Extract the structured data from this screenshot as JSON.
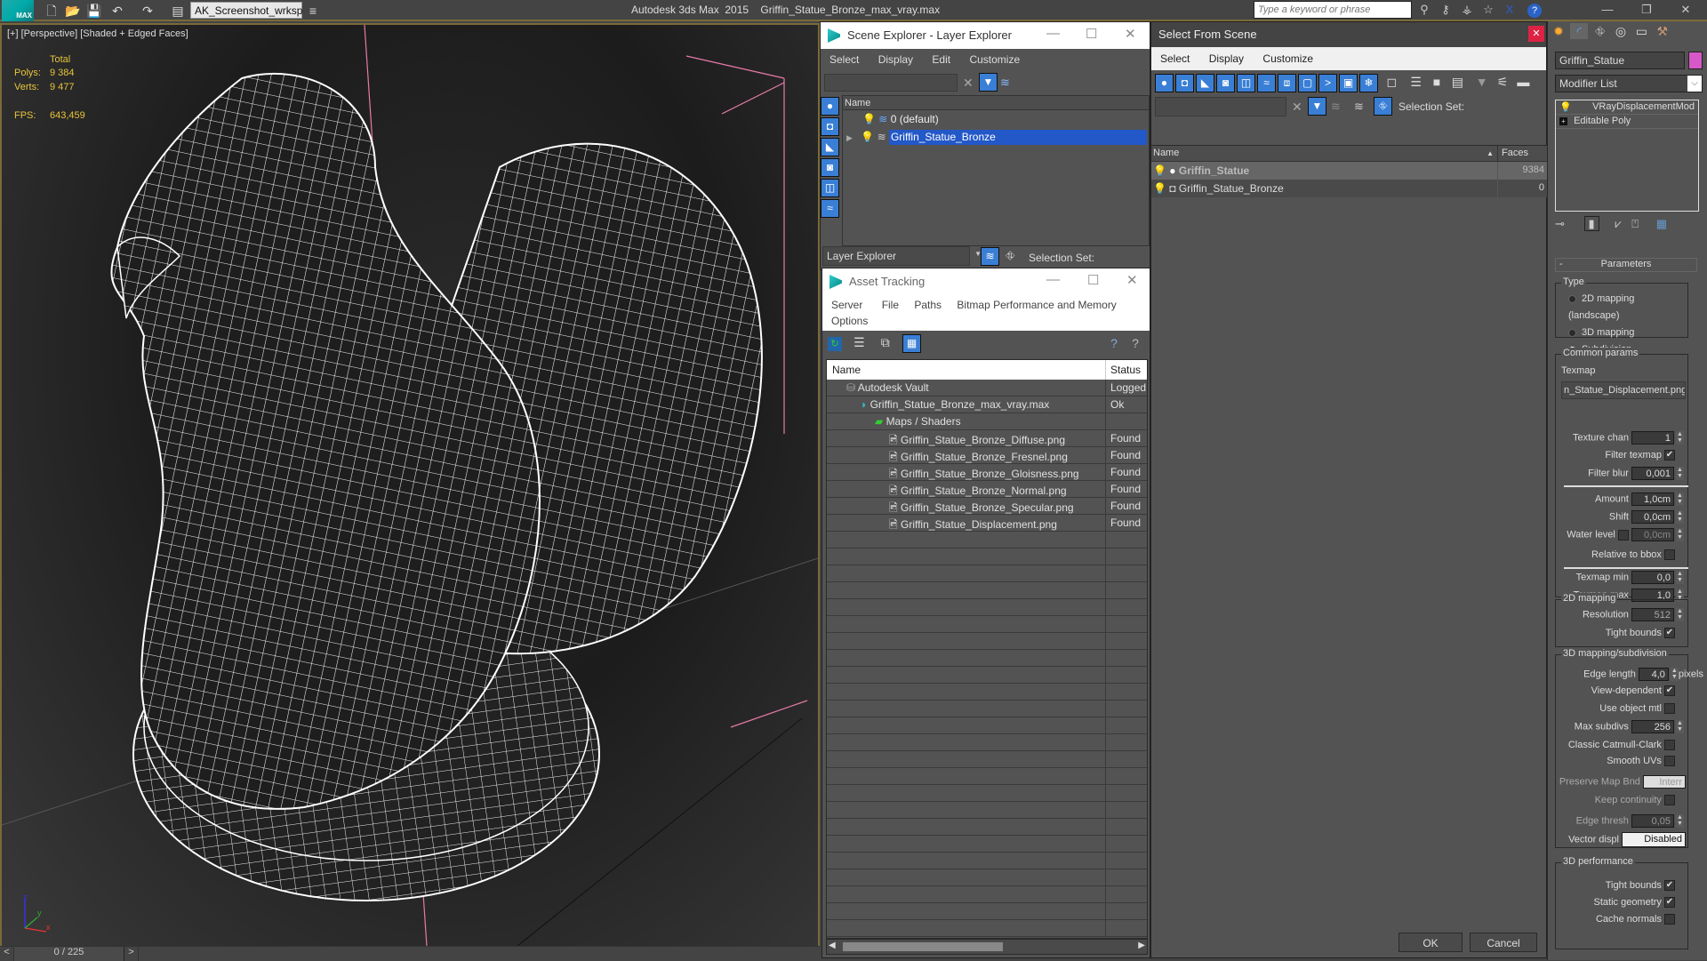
{
  "titlebar": {
    "workspace": "AK_Screenshot_wrksp",
    "app_title": "Autodesk 3ds Max  2015    Griffin_Statue_Bronze_max_vray.max",
    "search_placeholder": "Type a keyword or phrase"
  },
  "viewport": {
    "label": "[+] [Perspective] [Shaded + Edged Faces]",
    "stats_header": "Total",
    "polys_label": "Polys:",
    "polys_value": "9 384",
    "verts_label": "Verts:",
    "verts_value": "9 477",
    "fps_label": "FPS:",
    "fps_value": "643,459",
    "axis_x": "x",
    "axis_y": "y",
    "axis_z": "z"
  },
  "timeline": {
    "prev": "<",
    "frame": "0 / 225",
    "next": ">"
  },
  "scene_explorer": {
    "title": "Scene Explorer - Layer Explorer",
    "menu": [
      "Select",
      "Display",
      "Edit",
      "Customize"
    ],
    "column_name": "Name",
    "layers": [
      {
        "name": "0 (default)",
        "selected": false
      },
      {
        "name": "Griffin_Statue_Bronze",
        "selected": true
      }
    ],
    "footer_dropdown": "Layer Explorer",
    "selection_set_label": "Selection Set:"
  },
  "asset_tracking": {
    "title": "Asset Tracking",
    "menu": [
      "Server",
      "File",
      "Paths",
      "Bitmap Performance and Memory",
      "Options"
    ],
    "columns": [
      "Name",
      "Status"
    ],
    "rows": [
      {
        "name": "Autodesk Vault",
        "status": "Logged",
        "indent": 0,
        "icon": "vault-icon"
      },
      {
        "name": "Griffin_Statue_Bronze_max_vray.max",
        "status": "Ok",
        "indent": 1,
        "icon": "max-file-icon"
      },
      {
        "name": "Maps / Shaders",
        "status": "",
        "indent": 2,
        "icon": "maps-icon"
      },
      {
        "name": "Griffin_Statue_Bronze_Diffuse.png",
        "status": "Found",
        "indent": 3,
        "icon": "image-file-icon"
      },
      {
        "name": "Griffin_Statue_Bronze_Fresnel.png",
        "status": "Found",
        "indent": 3,
        "icon": "image-file-icon"
      },
      {
        "name": "Griffin_Statue_Bronze_Gloisness.png",
        "status": "Found",
        "indent": 3,
        "icon": "image-file-icon"
      },
      {
        "name": "Griffin_Statue_Bronze_Normal.png",
        "status": "Found",
        "indent": 3,
        "icon": "image-file-icon"
      },
      {
        "name": "Griffin_Statue_Bronze_Specular.png",
        "status": "Found",
        "indent": 3,
        "icon": "image-file-icon"
      },
      {
        "name": "Griffin_Statue_Displacement.png",
        "status": "Found",
        "indent": 3,
        "icon": "image-file-icon"
      }
    ]
  },
  "select_from_scene": {
    "title": "Select From Scene",
    "menu": [
      "Select",
      "Display",
      "Customize"
    ],
    "selection_set_label": "Selection Set:",
    "columns": [
      "Name",
      "Faces"
    ],
    "rows": [
      {
        "name": "Griffin_Statue",
        "faces": "9384",
        "selected": true
      },
      {
        "name": "Griffin_Statue_Bronze",
        "faces": "0",
        "selected": false
      }
    ],
    "ok": "OK",
    "cancel": "Cancel"
  },
  "command_panel": {
    "object_name": "Griffin_Statue",
    "object_color": "#d858c8",
    "modifier_list": "Modifier List",
    "stack": [
      "VRayDisplacementMod",
      "Editable Poly"
    ],
    "rollout_title": "Parameters",
    "type_group": "Type",
    "type_options": [
      {
        "label": "2D mapping (landscape)",
        "selected": false
      },
      {
        "label": "3D mapping",
        "selected": false
      },
      {
        "label": "Subdivision",
        "selected": true
      }
    ],
    "common_group": "Common params",
    "texmap_label": "Texmap",
    "texmap_value": "n_Statue_Displacement.png)",
    "texture_chan_label": "Texture chan",
    "texture_chan": "1",
    "filter_texmap_label": "Filter texmap",
    "filter_texmap": true,
    "filter_blur_label": "Filter blur",
    "filter_blur": "0,001",
    "amount_label": "Amount",
    "amount": "1,0cm",
    "shift_label": "Shift",
    "shift": "0,0cm",
    "water_level_label": "Water level",
    "water_level": "0,0cm",
    "relative_bbox_label": "Relative to bbox",
    "texmap_min_label": "Texmap min",
    "texmap_min": "0,0",
    "texmap_max_label": "Texmap max",
    "texmap_max": "1,0",
    "group_2d": "2D mapping",
    "resolution_label": "Resolution",
    "resolution": "512",
    "tight_bounds_label": "Tight bounds",
    "group_3d": "3D mapping/subdivision",
    "edge_length_label": "Edge length",
    "edge_length": "4,0",
    "pixels_label": "pixels",
    "view_dependent_label": "View-dependent",
    "use_object_mtl_label": "Use object mtl",
    "max_subdivs_label": "Max subdivs",
    "max_subdivs": "256",
    "catmull_label": "Classic Catmull-Clark",
    "smooth_uvs_label": "Smooth UVs",
    "preserve_label": "Preserve Map Bnd",
    "preserve_value": "Interr",
    "keep_continuity_label": "Keep continuity",
    "edge_thresh_label": "Edge thresh",
    "edge_thresh": "0,05",
    "vector_displ_label": "Vector displ",
    "vector_displ": "Disabled",
    "group_perf": "3D performance",
    "perf_tight_label": "Tight bounds",
    "static_geom_label": "Static geometry",
    "cache_normals_label": "Cache normals"
  }
}
